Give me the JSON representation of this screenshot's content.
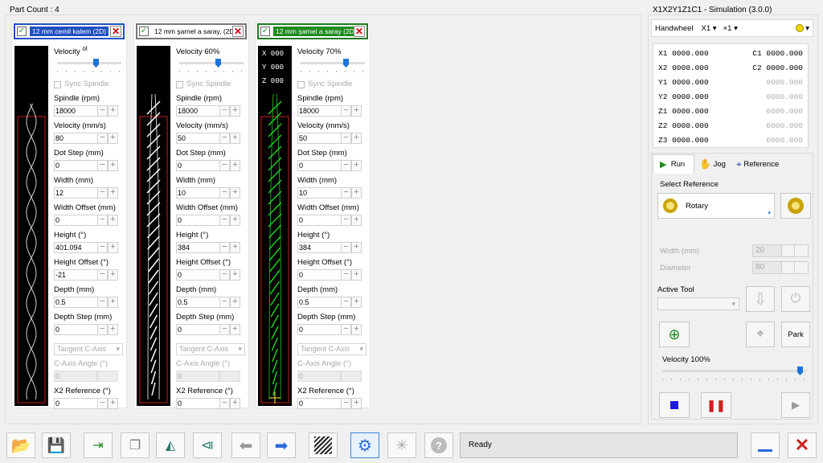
{
  "left_title": "Part Count : 4",
  "right_title": "X1X2Y1Z1C1 - Simulation (3.0.0)",
  "parts": [
    {
      "name": "12 mm cemil kalem (2D)",
      "header_color": "#1f4fc2",
      "header_bg": "#1f4fc2",
      "header_text_color": "#ffffff",
      "velocity_label": "Velocity",
      "velocity_suffix": "ol",
      "velocity_percent": 60,
      "sync": "Sync Spindle",
      "fields": [
        {
          "label": "Spindle (rpm)",
          "value": "18000"
        },
        {
          "label": "Velocity (mm/s)",
          "value": "80"
        },
        {
          "label": "Dot Step (mm)",
          "value": "0"
        },
        {
          "label": "Width (mm)",
          "value": "12"
        },
        {
          "label": "Width Offset (mm)",
          "value": "0"
        },
        {
          "label": "Height (°)",
          "value": "401.094"
        },
        {
          "label": "Height Offset (°)",
          "value": "-21"
        },
        {
          "label": "Depth (mm)",
          "value": "0.5"
        },
        {
          "label": "Depth Step (mm)",
          "value": "0"
        }
      ],
      "tangent": "Tangent C-Axis",
      "c_angle_label": "C-Axis Angle (°)",
      "c_angle_value": "0",
      "x2_label": "X2 Reference (°)",
      "x2_value": "0",
      "preview_color": "#d0d0d0"
    },
    {
      "name": "12 mm şarnel a saray, (2D)",
      "header_color": "#777777",
      "header_bg": "#ffffff",
      "header_text_color": "#000000",
      "velocity_label": "Velocity 60%",
      "velocity_suffix": "",
      "velocity_percent": 60,
      "sync": "Sync Spindle",
      "fields": [
        {
          "label": "Spindle (rpm)",
          "value": "18000"
        },
        {
          "label": "Velocity (mm/s)",
          "value": "50"
        },
        {
          "label": "Dot Step (mm)",
          "value": "0"
        },
        {
          "label": "Width (mm)",
          "value": "10"
        },
        {
          "label": "Width Offset (mm)",
          "value": "0"
        },
        {
          "label": "Height (°)",
          "value": "384"
        },
        {
          "label": "Height Offset (°)",
          "value": "0"
        },
        {
          "label": "Depth (mm)",
          "value": "0.5"
        },
        {
          "label": "Depth Step (mm)",
          "value": "0"
        }
      ],
      "tangent": "Tangent C-Axis",
      "c_angle_label": "C-Axis Angle (°)",
      "c_angle_value": "0",
      "x2_label": "X2 Reference (°)",
      "x2_value": "0",
      "preview_color": "#ffffff"
    },
    {
      "name": "12 mm şarnel a saray (2D)",
      "header_color": "#1e7a1e",
      "header_bg": "#1e8c1e",
      "header_text_color": "#ffffff",
      "velocity_label": "Velocity 70%",
      "velocity_suffix": "",
      "velocity_percent": 70,
      "sync": "Sync Spindle",
      "fields": [
        {
          "label": "Spindle (rpm)",
          "value": "18000"
        },
        {
          "label": "Velocity (mm/s)",
          "value": "50"
        },
        {
          "label": "Dot Step (mm)",
          "value": "0"
        },
        {
          "label": "Width (mm)",
          "value": "10"
        },
        {
          "label": "Width Offset (mm)",
          "value": "0"
        },
        {
          "label": "Height (°)",
          "value": "384"
        },
        {
          "label": "Height Offset (°)",
          "value": "0"
        },
        {
          "label": "Depth (mm)",
          "value": "0.5"
        },
        {
          "label": "Depth Step (mm)",
          "value": "0"
        }
      ],
      "tangent": "Tangent C-Axis",
      "c_angle_label": "C-Axis Angle (°)",
      "c_angle_value": "0",
      "x2_label": "X2 Reference (°)",
      "x2_value": "0",
      "preview_color": "#22cc22",
      "preview_coords": [
        "X 000",
        "Y 000",
        "Z 000"
      ]
    }
  ],
  "handwheel": {
    "label": "Handwheel",
    "axis": "X1",
    "step": "×1"
  },
  "coords": [
    {
      "a": "X1 0000.000",
      "b": "C1 0000.000",
      "active": true
    },
    {
      "a": "X2 0000.000",
      "b": "C2 0000.000",
      "active": true
    },
    {
      "a": "Y1 0000.000",
      "b": "0000.000",
      "active": false
    },
    {
      "a": "Y2 0000.000",
      "b": "0000.000",
      "active": false
    },
    {
      "a": "Z1 0000.000",
      "b": "0000.000",
      "active": false
    },
    {
      "a": "Z2 0000.000",
      "b": "0000.000",
      "active": false
    },
    {
      "a": "Z3 0000.000",
      "b": "0000.000",
      "active": false
    }
  ],
  "tabs": {
    "run": "Run",
    "jog": "Jog",
    "reference": "Reference"
  },
  "select_reference_label": "Select Reference",
  "reference_value": "Rotary",
  "width_label": "Width (mm)",
  "width_value": "20",
  "diameter_label": "Diameter",
  "diameter_value": "80",
  "active_tool_label": "Active Tool",
  "park_label": "Park",
  "velocity_label": "Velocity 100%",
  "velocity_percent": 95,
  "status": "Ready"
}
